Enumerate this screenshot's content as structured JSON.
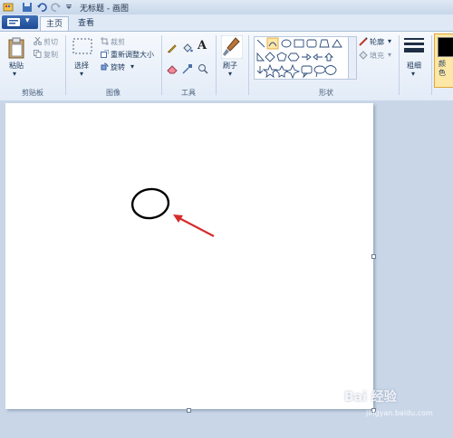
{
  "window": {
    "title": "无标题 - 画图"
  },
  "tabs": {
    "file_glyph": "▾",
    "home": "主页",
    "view": "查看"
  },
  "clipboard": {
    "paste": "粘贴",
    "cut": "剪切",
    "copy": "复制",
    "group": "剪贴板"
  },
  "image": {
    "select": "选择",
    "crop": "裁剪",
    "resize": "重新调整大小",
    "rotate": "旋转",
    "group": "图像"
  },
  "tools": {
    "group": "工具"
  },
  "brushes": {
    "label": "刷子"
  },
  "shapes": {
    "outline": "轮廓",
    "fill": "填充",
    "group": "形状"
  },
  "size": {
    "label": "粗细"
  },
  "colors": {
    "label": "颜色",
    "color1": "#000000",
    "accent": "#e8a63a"
  },
  "watermark": {
    "brand": "Bai 经验",
    "url": "jingyan.baidu.com"
  },
  "canvas": {
    "stroke_color": "#000000",
    "arrow_color": "#d62b2b"
  }
}
